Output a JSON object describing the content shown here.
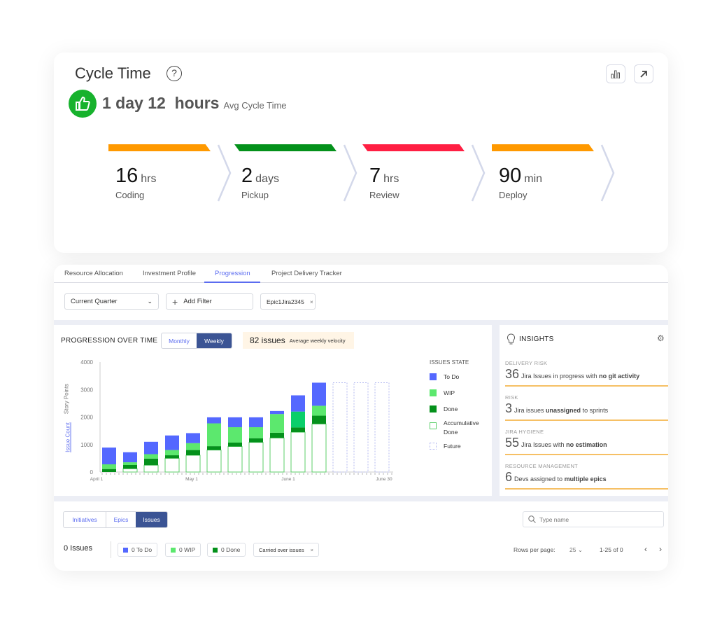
{
  "cycle_time": {
    "title": "Cycle Time",
    "help_icon": "question-circle-icon",
    "avg_value": "1 day 12  hours",
    "avg_label": "Avg Cycle Time",
    "stages": [
      {
        "value": "16",
        "unit": "hrs",
        "label": "Coding",
        "color": "#ff9900"
      },
      {
        "value": "2",
        "unit": "days",
        "label": "Pickup",
        "color": "#04911b"
      },
      {
        "value": "7",
        "unit": "hrs",
        "label": "Review",
        "color": "#ff1f43"
      },
      {
        "value": "90",
        "unit": "min",
        "label": "Deploy",
        "color": "#ff9900"
      }
    ]
  },
  "tabs": [
    {
      "label": "Resource Allocation"
    },
    {
      "label": "Investment Profile"
    },
    {
      "label": "Progression",
      "active": true
    },
    {
      "label": "Project Delivery Tracker"
    }
  ],
  "filters": {
    "period": "Current Quarter",
    "add_filter": "Add Filter",
    "chip": "Epic1Jira2345"
  },
  "progression": {
    "title": "PROGRESSION OVER TIME",
    "toggle": [
      "Monthly",
      "Weekly"
    ],
    "selected": "Weekly",
    "velocity_value": "82 issues",
    "velocity_label": "Average weekly velocity",
    "y_axis_labels": [
      "Story Points",
      "Issue Count"
    ],
    "legend_title": "ISSUES STATE",
    "legend": [
      {
        "label": "To Do",
        "color": "#5468ff"
      },
      {
        "label": "WIP",
        "color": "#5ce86e"
      },
      {
        "label": "Done",
        "color": "#04911b"
      },
      {
        "label": "Accumulative Done",
        "color": "#5ccf6a"
      },
      {
        "label": "Future",
        "color": "#b3b8f0"
      }
    ]
  },
  "chart_data": {
    "type": "bar",
    "stacked": true,
    "ylim": [
      0,
      4000
    ],
    "yticks": [
      "0",
      "1000",
      "2000",
      "3000",
      "4000"
    ],
    "x_labels": [
      "April 1",
      "May 1",
      "June 1",
      "June 30"
    ],
    "series": [
      {
        "name": "Accumulative Done",
        "values": [
          0,
          120,
          250,
          500,
          610,
          800,
          930,
          1080,
          1240,
          1450,
          1750
        ]
      },
      {
        "name": "Done",
        "values": [
          110,
          135,
          240,
          110,
          190,
          140,
          140,
          150,
          190,
          170,
          300
        ]
      },
      {
        "name": "WIP",
        "values": [
          170,
          100,
          160,
          190,
          250,
          830,
          560,
          400,
          680,
          580,
          360
        ]
      },
      {
        "name": "To Do",
        "values": [
          610,
          365,
          450,
          530,
          365,
          220,
          360,
          360,
          110,
          590,
          840
        ]
      }
    ],
    "future": {
      "count": 3,
      "value": 3250
    }
  },
  "insights": {
    "title": "INSIGHTS",
    "items": [
      {
        "label": "DELIVERY RISK",
        "num": "36",
        "text": "Jira Issues in progress with",
        "bold": "no git activity",
        "after": ""
      },
      {
        "label": "RISK",
        "num": "3",
        "text": "Jira issues",
        "bold": "unassigned",
        "after": "to sprints"
      },
      {
        "label": "JIRA HYGIENE",
        "num": "55",
        "text": "Jira Issues with",
        "bold": "no estimation",
        "after": ""
      },
      {
        "label": "RESOURCE MANAGEMENT",
        "num": "6",
        "text": "Devs assigned to",
        "bold": "multiple epics",
        "after": ""
      }
    ]
  },
  "table": {
    "segments": [
      "Initiatives",
      "Epics",
      "Issues"
    ],
    "selected": "Issues",
    "search_placeholder": "Type name",
    "count": "0 Issues",
    "chips": [
      "0 To Do",
      "0 WIP",
      "0 Done"
    ],
    "carried": "Carried over issues",
    "rows_label": "Rows per page:",
    "rows_value": "25",
    "range": "1-25 of 0"
  }
}
